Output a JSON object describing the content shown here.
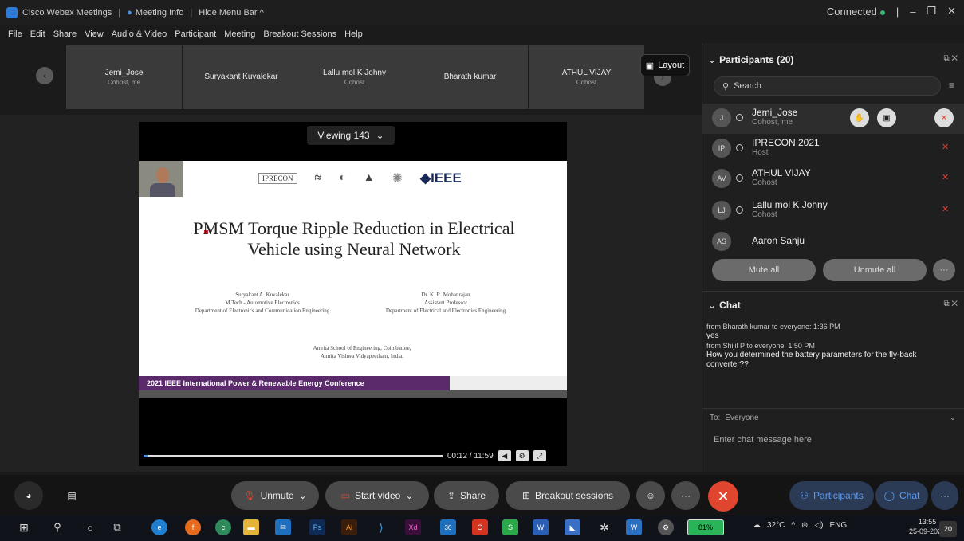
{
  "titlebar": {
    "app": "Cisco Webex Meetings",
    "meeting_info": "Meeting Info",
    "hide_menu": "Hide Menu Bar ^",
    "status": "Connected"
  },
  "menu": [
    "File",
    "Edit",
    "Share",
    "View",
    "Audio & Video",
    "Participant",
    "Meeting",
    "Breakout Sessions",
    "Help"
  ],
  "strip": {
    "tiles": [
      {
        "name": "Jemi_Jose",
        "role": "Cohost, me"
      },
      {
        "name": "Suryakant Kuvalekar",
        "role": ""
      },
      {
        "name": "Lallu mol K Johny",
        "role": "Cohost"
      },
      {
        "name": "Bharath kumar",
        "role": ""
      },
      {
        "name": "ATHUL VIJAY",
        "role": "Cohost"
      }
    ],
    "layout_label": "Layout"
  },
  "share": {
    "viewing": "Viewing 143",
    "time": "00:12 / 11:59",
    "progress": 0.017
  },
  "slide": {
    "logo_1": "IPRECON",
    "logo_ieee": "IEEE",
    "title": "PMSM Torque Ripple Reduction in Electrical Vehicle using Neural Network",
    "author_left": [
      "Suryakant A. Kuvalekar",
      "M.Tech - Automotive Electronics",
      "Department of Electronics and Communication Engineering"
    ],
    "author_right": [
      "Dr. K. R. Mohanrajan",
      "Assistant Professor",
      "Department of Electrical and Electronics Engineering"
    ],
    "school": [
      "Amrita School of Engineering, Coimbatore,",
      "Amrita Vishwa Vidyapeetham, India."
    ],
    "conference": "2021 IEEE International Power & Renewable Energy Conference"
  },
  "participants": {
    "header": "Participants (20)",
    "search_placeholder": "Search",
    "list": [
      {
        "initials": "J",
        "name": "Jemi_Jose",
        "role": "Cohost, me"
      },
      {
        "initials": "IP",
        "name": "IPRECON 2021",
        "role": "Host"
      },
      {
        "initials": "AV",
        "name": "ATHUL VIJAY",
        "role": "Cohost"
      },
      {
        "initials": "LJ",
        "name": "Lallu mol K Johny",
        "role": "Cohost"
      },
      {
        "initials": "AS",
        "name": "Aaron Sanju",
        "role": ""
      }
    ],
    "mute_all": "Mute all",
    "unmute_all": "Unmute all"
  },
  "chat": {
    "header": "Chat",
    "messages": [
      {
        "from": "from Bharath kumar to everyone:   1:36 PM",
        "text": "yes"
      },
      {
        "from": "from Shijil P to everyone:   1:50 PM",
        "text": "How you determined the battery parameters for the fly-back converter??"
      }
    ],
    "to_label": "To:",
    "to_value": "Everyone",
    "input_placeholder": "Enter chat message here"
  },
  "controls": {
    "unmute": "Unmute",
    "start_video": "Start video",
    "share": "Share",
    "breakout": "Breakout sessions",
    "participants": "Participants",
    "chat": "Chat"
  },
  "taskbar": {
    "battery": "81%",
    "temp": "32°C",
    "lang": "ENG",
    "time": "13:55",
    "date": "25-09-2021",
    "notifications": "20",
    "badge_30": "30"
  },
  "colors": {
    "accent_blue": "#4a90e2",
    "end_red": "#e0452f",
    "conference_band": "#5a2a6a"
  }
}
